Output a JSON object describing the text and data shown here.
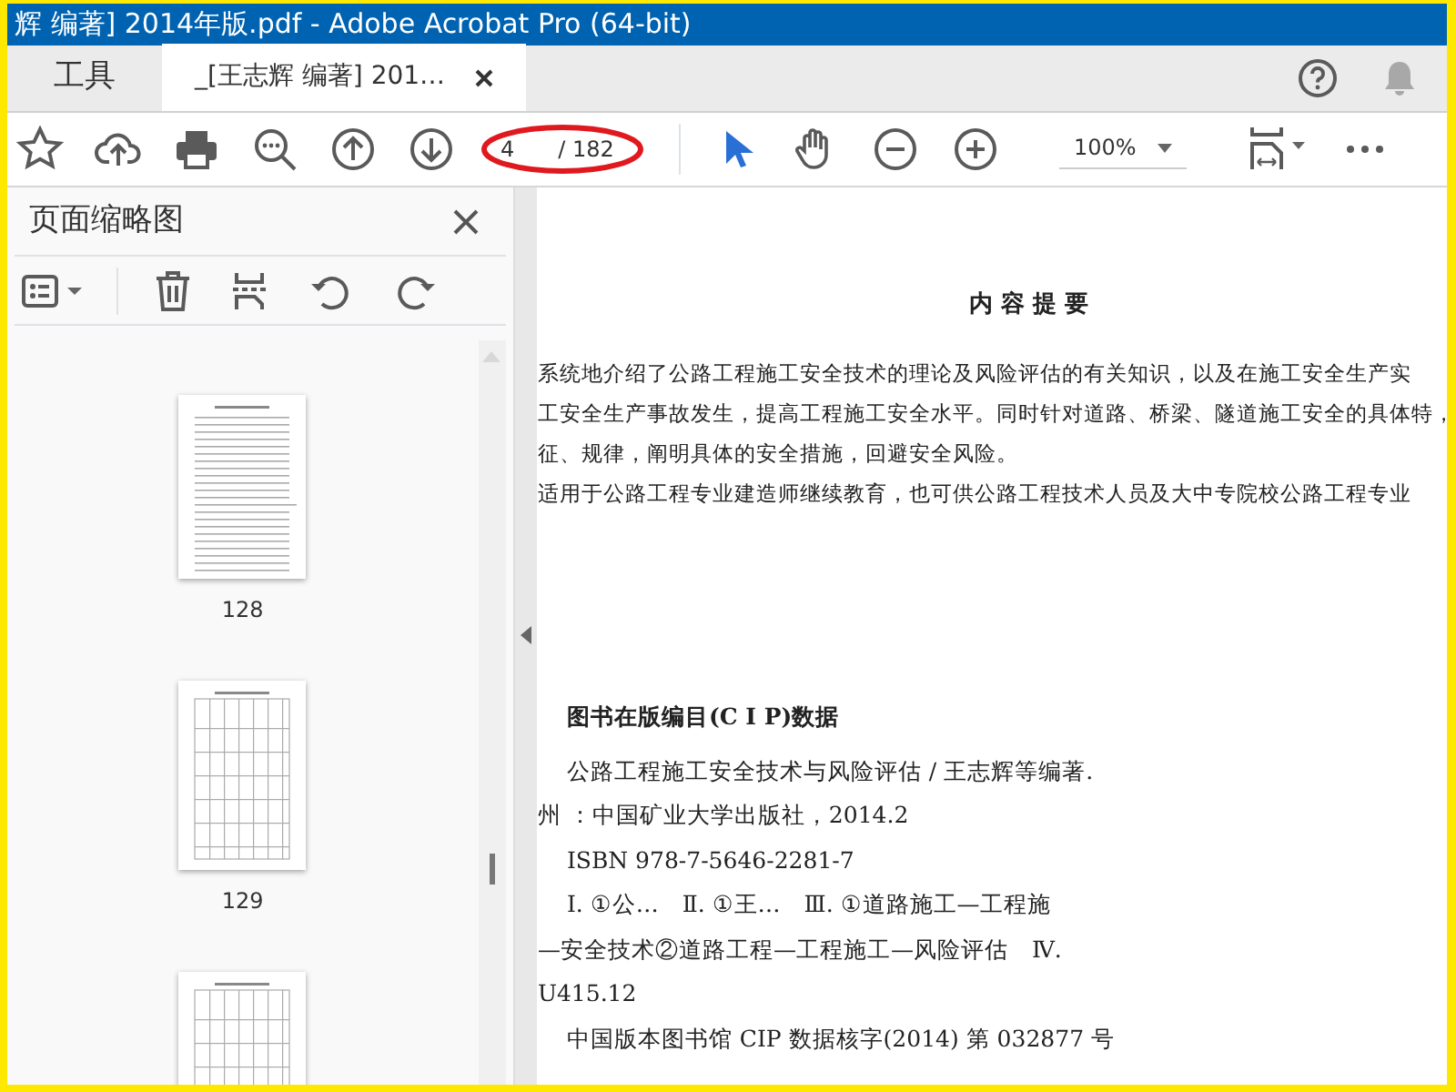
{
  "window": {
    "title": "辉 编著] 2014年版.pdf - Adobe Acrobat Pro (64-bit)"
  },
  "tabs": [
    {
      "label": "工具",
      "selected": false,
      "closable": false
    },
    {
      "label": "_[王志辉 编著] 201…",
      "selected": true,
      "closable": true
    }
  ],
  "toolbar": {
    "page_current": "4",
    "page_total": "/ 182",
    "zoom": "100%",
    "select_tool": {
      "selected": true
    },
    "hand_tool": {
      "selected": false
    }
  },
  "sidebar": {
    "title": "页面缩略图",
    "thumbnails": [
      {
        "label": "128",
        "kind": "table"
      },
      {
        "label": "129",
        "kind": "grid"
      },
      {
        "kind": "grid"
      }
    ]
  },
  "document": {
    "heading": "内 容 提 要",
    "paragraphs": [
      "系统地介绍了公路工程施工安全技术的理论及风险评估的有关知识，以及在施工安全生产实",
      "工安全生产事故发生，提高工程施工安全水平。同时针对道路、桥梁、隧道施工安全的具体特，",
      "征、规律，阐明具体的安全措施，回避安全风险。",
      "适用于公路工程专业建造师继续教育，也可供公路工程技术人员及大中专院校公路工程专业"
    ],
    "cip_heading": "图书在版编目(C I P)数据",
    "cip_lines": [
      {
        "text": "公路工程施工安全技术与风险评估 / 王志辉等编著.",
        "indent": true
      },
      {
        "text": "州 ：中国矿业大学出版社，2014.2",
        "indent": false
      },
      {
        "text": "ISBN 978-7-5646-2281-7",
        "indent": true
      },
      {
        "text": "Ⅰ. ①公…　Ⅱ. ①王…　Ⅲ. ①道路施工—工程施",
        "indent": true
      },
      {
        "text": "—安全技术②道路工程—工程施工—风险评估　Ⅳ.",
        "indent": false
      },
      {
        "text": "U415.12",
        "indent": false
      },
      {
        "text": "中国版本图书馆 CIP 数据核字(2014) 第 032877 号",
        "indent": true
      }
    ]
  }
}
